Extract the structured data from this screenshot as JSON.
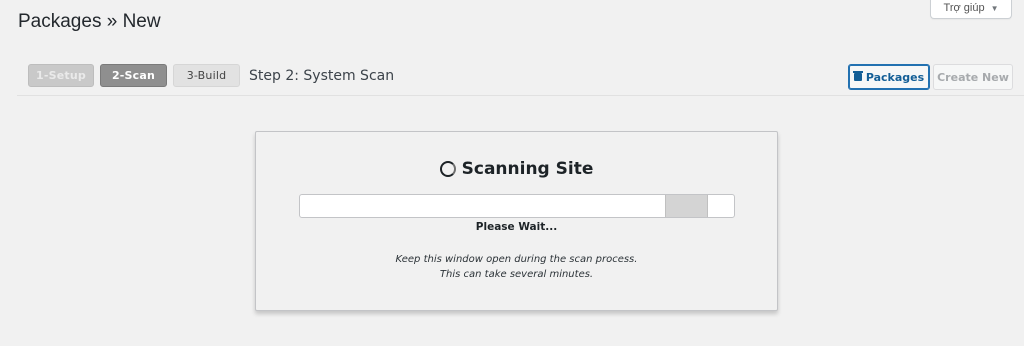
{
  "header": {
    "title": "Packages » New",
    "help_tab_label": "Trợ giúp",
    "help_tab_icon": "caret-down-icon"
  },
  "steps": [
    {
      "label": "1-Setup",
      "state": "completed"
    },
    {
      "label": "2-Scan",
      "state": "active"
    },
    {
      "label": "3-Build",
      "state": "pending"
    }
  ],
  "step_title": "Step 2: System Scan",
  "buttons": {
    "packages_label": "Packages",
    "packages_icon": "archive-icon",
    "create_new_label": "Create New",
    "create_new_disabled": true
  },
  "scan": {
    "heading": "Scanning Site",
    "heading_icon": "spinner-icon",
    "progress_indicator": {
      "start_fraction": 0.84,
      "end_fraction": 0.94,
      "indeterminate": true
    },
    "status_text": "Please Wait...",
    "note_line1": "Keep this window open during the scan process.",
    "note_line2": "This can take several minutes."
  },
  "colors": {
    "background": "#f1f1f1",
    "accent": "#2271b1",
    "step_active": "#8f8f8f"
  }
}
